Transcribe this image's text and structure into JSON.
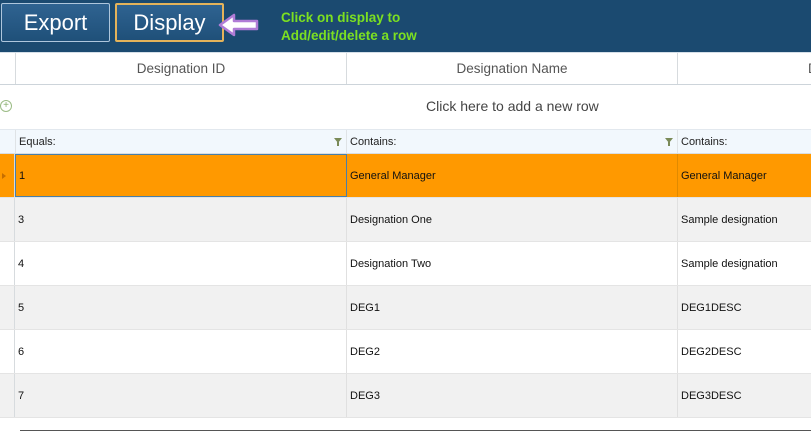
{
  "toolbar": {
    "export_label": "Export",
    "display_label": "Display",
    "hint_line1": "Click on display to",
    "hint_line2": "Add/edit/delete a row",
    "arrow_icon": "left-arrow-icon",
    "colors": {
      "background": "#1b4a70",
      "hint": "#7ce021",
      "display_border": "#e4b35a"
    }
  },
  "grid": {
    "columns": [
      "Designation ID",
      "Designation Name",
      "D"
    ],
    "add_row_text": "Click here to add a new row",
    "add_icon": "plus-circle-icon",
    "filter_icon": "filter-funnel-icon",
    "filters": [
      "Equals:",
      "Contains:",
      "Contains:"
    ],
    "selected_row_color": "#ff9900",
    "rows": [
      {
        "id": "1",
        "name": "General Manager",
        "description": "General Manager",
        "selected": true
      },
      {
        "id": "3",
        "name": "Designation One",
        "description": "Sample designation"
      },
      {
        "id": "4",
        "name": "Designation Two",
        "description": "Sample designation"
      },
      {
        "id": "5",
        "name": "DEG1",
        "description": "DEG1DESC"
      },
      {
        "id": "6",
        "name": "DEG2",
        "description": "DEG2DESC"
      },
      {
        "id": "7",
        "name": "DEG3",
        "description": "DEG3DESC"
      }
    ]
  }
}
